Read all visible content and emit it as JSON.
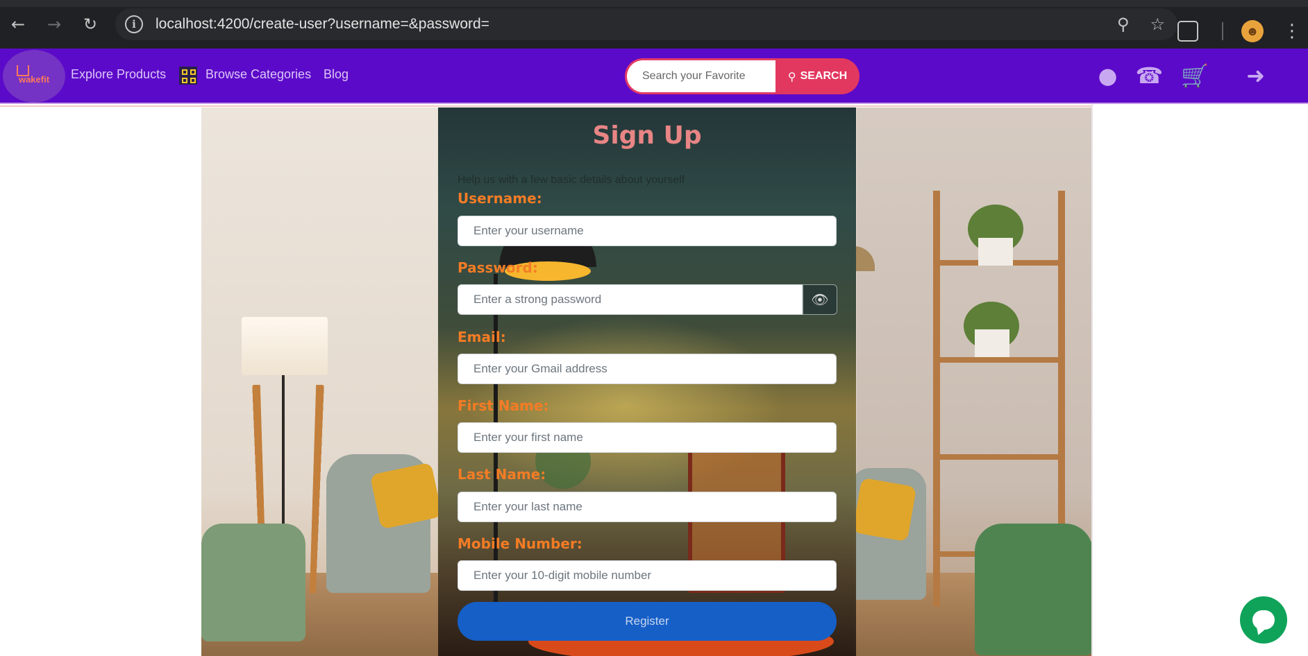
{
  "browser": {
    "url": "localhost:4200/create-user?username=&password=",
    "back_icon": "arrow-left-icon",
    "forward_icon": "arrow-right-icon",
    "reload_icon": "reload-icon",
    "info_icon": "info-icon",
    "zoom_icon": "zoom-icon",
    "star_icon": "star-icon",
    "extensions_icon": "puzzle-icon",
    "profile_icon": "profile-avatar",
    "menu_icon": "kebab-menu-icon"
  },
  "navbar": {
    "logo_text": "wakefit",
    "links": [
      "Explore Products",
      "Browse Categories",
      "Blog"
    ],
    "search_placeholder": "Search your Favorite",
    "search_button": "SEARCH",
    "icons": [
      "user-icon",
      "phone-icon",
      "cart-icon",
      "sign-in-icon"
    ],
    "background": "#5c0ac9"
  },
  "form": {
    "title": "Sign Up",
    "subtitle": "Help us with a few basic details about yourself",
    "fields": [
      {
        "label": "Username:",
        "placeholder": "Enter your username"
      },
      {
        "label": "Password:",
        "placeholder": "Enter a strong password"
      },
      {
        "label": "Email:",
        "placeholder": "Enter your Gmail address"
      },
      {
        "label": "First Name:",
        "placeholder": "Enter your first name"
      },
      {
        "label": "Last Name:",
        "placeholder": "Enter your last name"
      },
      {
        "label": "Mobile Number:",
        "placeholder": "Enter your 10-digit mobile number"
      }
    ],
    "register_button": "Register",
    "label_color": "#f47c25",
    "title_color": "#e88585",
    "button_color": "#155fc7"
  },
  "chat": {
    "icon": "chat-bubble-icon",
    "color": "#0fa35a"
  }
}
